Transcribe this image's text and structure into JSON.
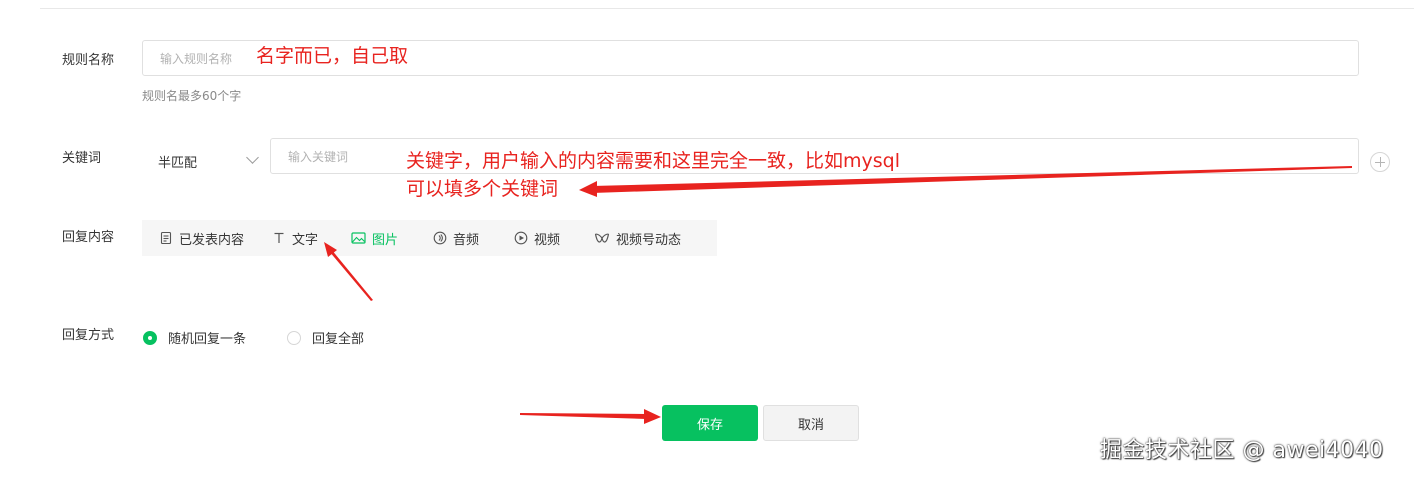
{
  "form": {
    "rule_name": {
      "label": "规则名称",
      "placeholder": "输入规则名称",
      "hint": "规则名最多60个字"
    },
    "keyword": {
      "label": "关键词",
      "match_mode": "半匹配",
      "placeholder": "输入关键词"
    },
    "reply_content": {
      "label": "回复内容",
      "tabs": [
        {
          "label": "已发表内容",
          "icon": "document-icon"
        },
        {
          "label": "文字",
          "icon": "text-icon"
        },
        {
          "label": "图片",
          "icon": "image-icon",
          "active": true
        },
        {
          "label": "音频",
          "icon": "audio-icon"
        },
        {
          "label": "视频",
          "icon": "video-icon"
        },
        {
          "label": "视频号动态",
          "icon": "channels-icon"
        }
      ]
    },
    "reply_mode": {
      "label": "回复方式",
      "options": [
        {
          "label": "随机回复一条",
          "checked": true
        },
        {
          "label": "回复全部",
          "checked": false
        }
      ]
    },
    "buttons": {
      "save": "保存",
      "cancel": "取消"
    }
  },
  "annotations": {
    "rule_name_note": "名字而已，自己取",
    "keyword_note_line1": "关键字，用户输入的内容需要和这里完全一致，比如mysql",
    "keyword_note_line2": "可以填多个关键词"
  },
  "watermark": "掘金技术社区 @ awei4040",
  "colors": {
    "accent": "#07c160",
    "annotation": "#e8231f"
  }
}
